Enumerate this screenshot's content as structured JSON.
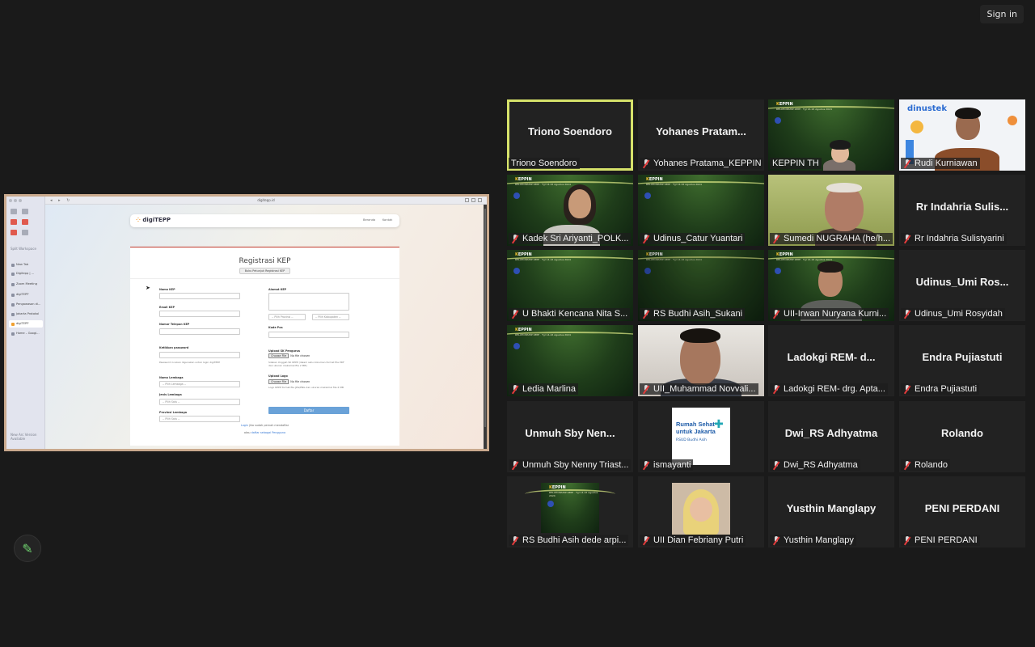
{
  "top": {
    "sign_in": "Sign in"
  },
  "share": {
    "url": "digitepp.id",
    "sidebar_section": "Split Workspace",
    "sidebar_tabs": [
      "New Tab",
      "Digitepp | ...",
      "Zoom Meeting",
      "digiTEPP",
      "Pengawasan di...",
      "Jakarta Protokol",
      "digiTEPP",
      "Home – Googl..."
    ],
    "sidebar_footer": "New Arc Version Available",
    "nav_logo_prefix": "digi",
    "nav_logo_suffix": "TEPP",
    "nav_links": [
      "Beranda",
      "Kontak"
    ],
    "form": {
      "title": "Registrasi KEP",
      "guide_button": "Buku Petunjuk Registrasi KEP",
      "labels": {
        "nama": "Nama KEP",
        "email": "Email KEP",
        "telepon": "Nomor Telepon KEP",
        "password": "Ketikkan password",
        "nama_lembaga": "Nama Lembaga",
        "jenis_lembaga": "Jenis Lembaga",
        "provinsi": "Provinsi Lembaga",
        "alamat": "Alamat KEP",
        "kode_pos": "Kode Pos",
        "sk": "Upload SK Pengurus",
        "logo": "Upload Logo"
      },
      "password_hint": "Password ini akan digunakan untuk login digiTEPP",
      "placeholders": {
        "nama_lembaga": "-- Pilih Lembaga --",
        "jenis_lembaga": "-- Pilih Satu --",
        "provinsi": "-- Pilih Satu --",
        "provinsi2": "-- Pilih Provinsi --",
        "kabupaten": "-- Pilih Kabupaten --"
      },
      "file_button": "Choose File",
      "file_status": "No file chosen",
      "sk_hint": "Silakan Unggah SK KEPP (dalam satu dokumen format file PDF dan ukuran maksimal file 2 MB)",
      "logo_hint": "Logo KEPP format file JPG/PNG dan ukuran maksimal file 2 MB",
      "submit": "Daftar",
      "footer1_link": "Login",
      "footer1_text": " jika sudah pernah mendaftar",
      "footer2_text": "atau ",
      "footer2_link": "daftar sebagai Pengguna"
    }
  },
  "participants": [
    {
      "display": "Triono Soendoro",
      "label": "Triono Soendoro",
      "muted": false,
      "active": true,
      "video": "none"
    },
    {
      "display": "Yohanes Pratam...",
      "label": "Yohanes Pratama_KEPPIN",
      "muted": true,
      "video": "none"
    },
    {
      "display": "",
      "label": "KEPPIN TH",
      "muted": false,
      "video": "green-person"
    },
    {
      "display": "",
      "label": "Rudi Kurniawan",
      "muted": true,
      "video": "dinustek"
    },
    {
      "display": "",
      "label": "Kadek Sri Ariyanti_POLK...",
      "muted": true,
      "video": "green-woman"
    },
    {
      "display": "",
      "label": "Udinus_Catur Yuantari",
      "muted": true,
      "video": "green"
    },
    {
      "display": "",
      "label": "Sumedi NUGRAHA (he/h...",
      "muted": true,
      "video": "man-glasses"
    },
    {
      "display": "Rr Indahria Sulis...",
      "label": "Rr Indahria Sulistyarini",
      "muted": true,
      "video": "none"
    },
    {
      "display": "",
      "label": "U Bhakti Kencana Nita S...",
      "muted": true,
      "video": "green"
    },
    {
      "display": "",
      "label": "RS Budhi Asih_Sukani",
      "muted": true,
      "video": "green-dark"
    },
    {
      "display": "",
      "label": "UII-Irwan Nuryana Kurni...",
      "muted": true,
      "video": "green-man"
    },
    {
      "display": "Udinus_Umi Ros...",
      "label": "Udinus_Umi Rosyidah",
      "muted": true,
      "video": "none"
    },
    {
      "display": "",
      "label": "Ledia Marlina",
      "muted": true,
      "video": "green"
    },
    {
      "display": "",
      "label": "UII_Muhammad Novvali...",
      "muted": true,
      "video": "man-close"
    },
    {
      "display": "Ladokgi REM- d...",
      "label": "Ladokgi REM- drg. Apta...",
      "muted": true,
      "video": "none"
    },
    {
      "display": "Endra Pujiastuti",
      "label": "Endra Pujiastuti",
      "muted": true,
      "video": "none"
    },
    {
      "display": "Unmuh Sby Nen...",
      "label": "Unmuh Sby Nenny Triast...",
      "muted": true,
      "video": "none"
    },
    {
      "display": "",
      "label": "ismayanti",
      "muted": true,
      "video": "rumah-sehat"
    },
    {
      "display": "Dwi_RS Adhyatma",
      "label": "Dwi_RS Adhyatma",
      "muted": true,
      "video": "none"
    },
    {
      "display": "Rolando",
      "label": "Rolando",
      "muted": true,
      "video": "none"
    },
    {
      "display": "",
      "label": "RS Budhi Asih dede arpi...",
      "muted": true,
      "video": "green-small"
    },
    {
      "display": "",
      "label": "UII Dian Febriany Putri",
      "muted": true,
      "video": "hijab-photo"
    },
    {
      "display": "Yusthin Manglapy",
      "label": "Yusthin Manglapy",
      "muted": true,
      "video": "none"
    },
    {
      "display": "PENI PERDANI",
      "label": "PENI PERDANI",
      "muted": true,
      "video": "none"
    }
  ],
  "rumah_sehat": {
    "line1": "Rumah Sehat",
    "line2": "untuk Jakarta",
    "line3": "RSUD Budhi Asih"
  },
  "dinustek": "dinustek",
  "keppin": {
    "brand_k": "K",
    "brand_rest": "EPPIN",
    "sub": "RELATIONSHIP KEPP · Tgl 14-16 Agustus 2024"
  },
  "colors": {
    "background": "#1a1a1a",
    "active_speaker": "#d6e26a",
    "mute": "#e23b3b"
  }
}
